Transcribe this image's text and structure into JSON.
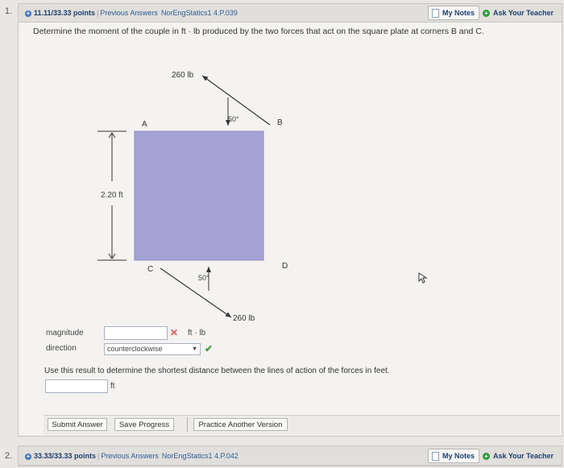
{
  "question1": {
    "number": "1.",
    "points": "11.11/33.33 points",
    "previous_answers": "Previous Answers",
    "reference": "NorEngStatics1 4.P.039",
    "my_notes": "My Notes",
    "ask_teacher": "Ask Your Teacher",
    "prompt": "Determine the moment of the couple in ft · lb produced by the two forces that act on the square plate at corners B and C.",
    "figure": {
      "force_top_label": "260 lb",
      "force_bottom_label": "260 lb",
      "angle_top_label": "50°",
      "angle_bottom_label": "50°",
      "corner_a": "A",
      "corner_b": "B",
      "corner_c": "C",
      "corner_d": "D",
      "side_length_label": "2.20 ft",
      "plate_color": "#a6a2d6"
    },
    "magnitude_label": "magnitude",
    "magnitude_value": "",
    "magnitude_unit": "ft · lb",
    "magnitude_status": "✕",
    "direction_label": "direction",
    "direction_value": "counterclockwise",
    "direction_status": "✔",
    "followup_prompt": "Use this result to determine the shortest distance between the lines of action of the forces in feet.",
    "distance_value": "",
    "distance_unit": "ft",
    "buttons": {
      "submit": "Submit Answer",
      "save": "Save Progress",
      "practice": "Practice Another Version"
    }
  },
  "question2": {
    "number": "2.",
    "points": "33.33/33.33 points",
    "previous_answers": "Previous Answers",
    "reference": "NorEngStatics1 4.P.042",
    "my_notes": "My Notes",
    "ask_teacher": "Ask Your Teacher"
  },
  "colors": {
    "header_bg": "#e1dfdb",
    "link": "#1d3f73",
    "incorrect": "#d9534f",
    "correct": "#4a9a3a"
  }
}
